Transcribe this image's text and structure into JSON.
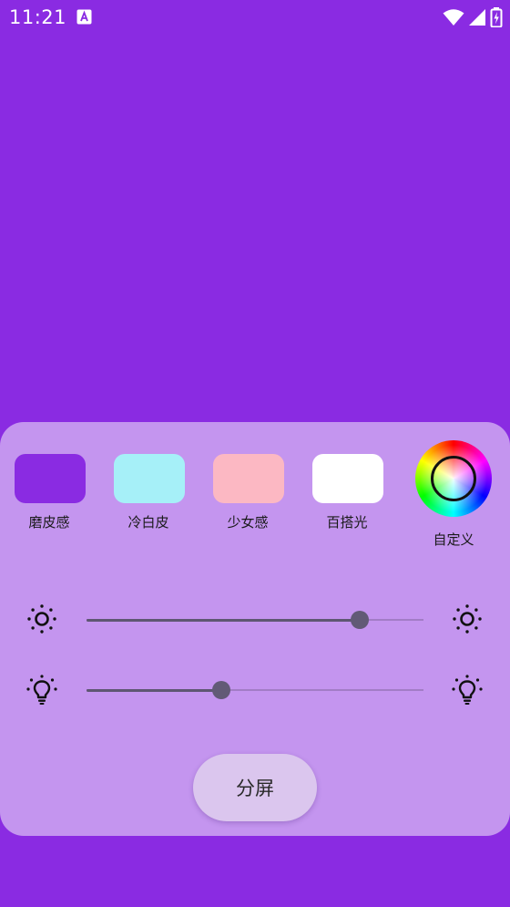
{
  "status_bar": {
    "time": "11:21"
  },
  "colors": {
    "background": "#8a2be2",
    "panel": "#c495ef"
  },
  "presets": [
    {
      "label": "磨皮感",
      "color": "#8a2be2"
    },
    {
      "label": "冷白皮",
      "color": "#a6f0f8"
    },
    {
      "label": "少女感",
      "color": "#fcb8c3"
    },
    {
      "label": "百搭光",
      "color": "#ffffff"
    }
  ],
  "custom": {
    "label": "自定义",
    "icon": "color-wheel-icon"
  },
  "sliders": [
    {
      "name": "brightness",
      "icon": "sun-icon",
      "value_fraction": 0.81
    },
    {
      "name": "light",
      "icon": "lightbulb-icon",
      "value_fraction": 0.4
    }
  ],
  "split_button": {
    "label": "分屏"
  }
}
